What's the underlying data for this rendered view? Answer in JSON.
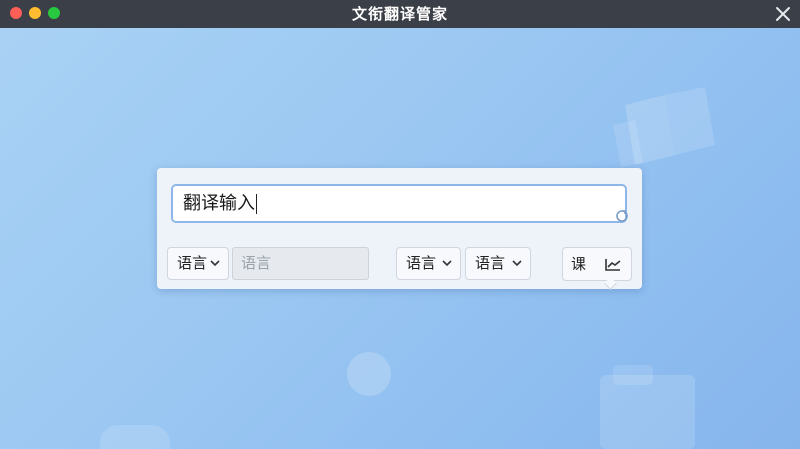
{
  "window": {
    "title": "文衔翻译管家"
  },
  "translate": {
    "input_value": "翻译输入",
    "source_lang_button": "语言",
    "source_lang_field_placeholder": "语言",
    "target_lang_button_1": "语言",
    "target_lang_button_2": "语言",
    "action_button_label": "课"
  },
  "icons": {
    "close": "close-icon",
    "chevron": "chevron-down-icon",
    "input_corner": "refresh-icon",
    "action": "chart-icon"
  },
  "colors": {
    "titlebar": "#3b3f47",
    "traffic_red": "#ff5f57",
    "traffic_yellow": "#febc2e",
    "traffic_green": "#28c840",
    "background": "#9cc8f2",
    "input_border": "#8fb6e8"
  }
}
